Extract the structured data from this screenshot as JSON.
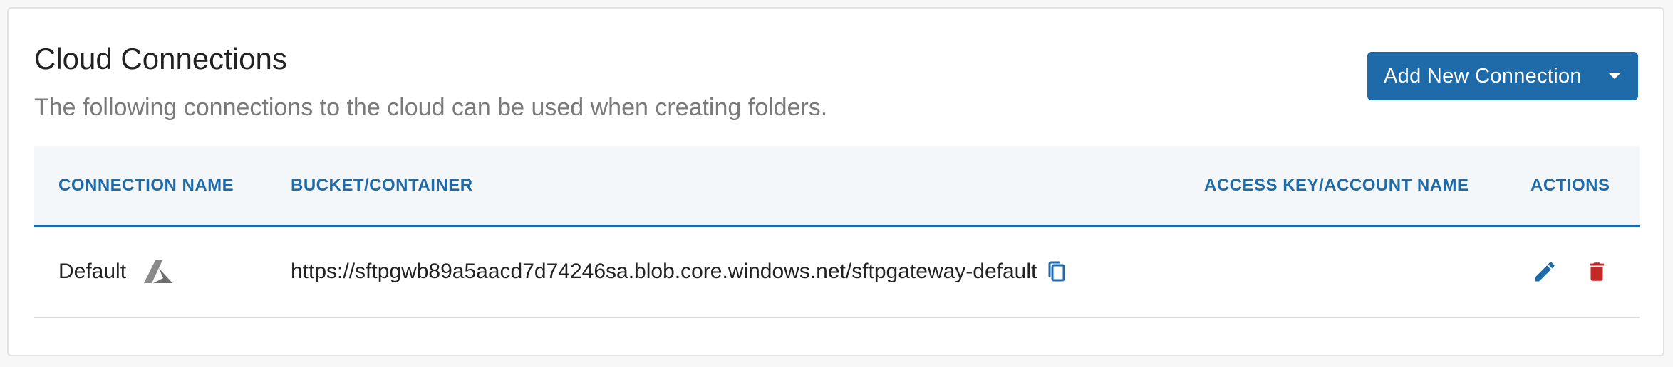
{
  "header": {
    "title": "Cloud Connections",
    "subtitle": "The following connections to the cloud can be used when creating folders.",
    "add_button_label": "Add New Connection"
  },
  "table": {
    "columns": [
      "CONNECTION NAME",
      "BUCKET/CONTAINER",
      "ACCESS KEY/ACCOUNT NAME",
      "ACTIONS"
    ],
    "rows": [
      {
        "connection_name": "Default",
        "provider_icon": "azure-icon",
        "bucket_container": "https://sftpgwb89a5aacd7d74246sa.blob.core.windows.net/sftpgateway-default",
        "access_key_account_name": ""
      }
    ]
  },
  "colors": {
    "primary": "#1f6aa8",
    "danger": "#c62828",
    "header_bg": "#f3f7fa",
    "azure_grey": "#7a7a7a"
  },
  "icons": {
    "copy": "copy-icon",
    "edit": "pencil-icon",
    "delete": "trash-icon",
    "dropdown": "caret-down-icon"
  }
}
